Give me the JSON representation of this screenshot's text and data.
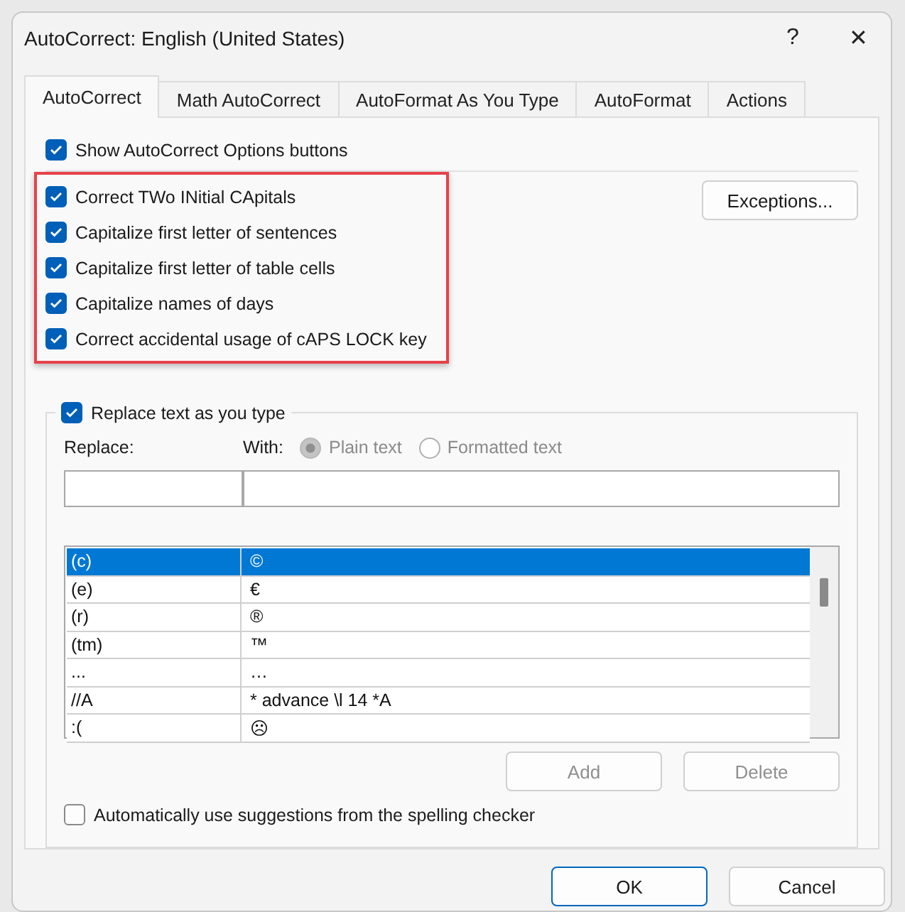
{
  "window": {
    "title": "AutoCorrect: English (United States)",
    "help": "?",
    "close": "✕"
  },
  "tabs": [
    {
      "label": "AutoCorrect",
      "selected": true
    },
    {
      "label": "Math AutoCorrect",
      "selected": false
    },
    {
      "label": "AutoFormat As You Type",
      "selected": false
    },
    {
      "label": "AutoFormat",
      "selected": false
    },
    {
      "label": "Actions",
      "selected": false
    }
  ],
  "show_options": {
    "label": "Show AutoCorrect Options buttons",
    "checked": true
  },
  "rules": {
    "highlighted": true,
    "items": [
      {
        "label": "Correct TWo INitial CApitals",
        "checked": true
      },
      {
        "label": "Capitalize first letter of sentences",
        "checked": true
      },
      {
        "label": "Capitalize first letter of table cells",
        "checked": true
      },
      {
        "label": "Capitalize names of days",
        "checked": true
      },
      {
        "label": "Correct accidental usage of cAPS LOCK key",
        "checked": true
      }
    ]
  },
  "exceptions_button": "Exceptions...",
  "replace_group": {
    "label": "Replace text as you type",
    "checked": true,
    "replace_label": "Replace:",
    "with_label": "With:",
    "format_options": [
      {
        "label": "Plain text",
        "selected": true
      },
      {
        "label": "Formatted text",
        "selected": false
      }
    ],
    "rows": [
      {
        "replace": "(c)",
        "with": "©",
        "selected": true
      },
      {
        "replace": "(e)",
        "with": "€",
        "selected": false
      },
      {
        "replace": "(r)",
        "with": "®",
        "selected": false
      },
      {
        "replace": "(tm)",
        "with": "™",
        "selected": false
      },
      {
        "replace": "...",
        "with": "…",
        "selected": false
      },
      {
        "replace": "//A",
        "with": "* advance \\l 14 *A",
        "selected": false
      },
      {
        "replace": ":(",
        "with": "☹",
        "selected": false
      }
    ],
    "add_button": "Add",
    "delete_button": "Delete",
    "spelling": {
      "label": "Automatically use suggestions from the spelling checker",
      "checked": false
    }
  },
  "buttons": [
    {
      "label": "OK",
      "kind": "primary"
    },
    {
      "label": "Cancel",
      "kind": "normal"
    }
  ]
}
